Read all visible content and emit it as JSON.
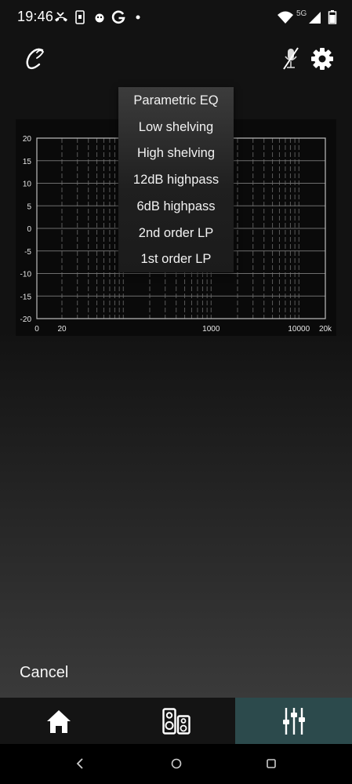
{
  "status_bar": {
    "time": "19:46",
    "network": "5G",
    "icons": [
      "missed-call-icon",
      "phone-debug-icon",
      "alarm-icon",
      "google-icon",
      "dot-icon",
      "wifi-icon",
      "signal-icon",
      "battery-icon"
    ]
  },
  "header": {
    "logo_icon": "app-logo-icon",
    "icons": [
      "mic-muted-icon",
      "gear-icon"
    ]
  },
  "chart_data": {
    "type": "line",
    "title": "",
    "xlabel": "",
    "ylabel": "",
    "x_scale": "log",
    "x_range": [
      0,
      20000
    ],
    "x_tick_labels": [
      "0",
      "20",
      "1000",
      "10000",
      "20k"
    ],
    "ylim": [
      -20,
      20
    ],
    "y_tick_labels": [
      "20",
      "15",
      "10",
      "5",
      "0",
      "-5",
      "-10",
      "-15",
      "-20"
    ],
    "grid": true,
    "series": []
  },
  "dropdown": {
    "items": [
      "Parametric EQ",
      "Low shelving",
      "High shelving",
      "12dB highpass",
      "6dB highpass",
      "2nd order LP",
      "1st order LP"
    ]
  },
  "cancel_label": "Cancel",
  "bottom_nav": {
    "tabs": [
      {
        "icon": "home-icon",
        "active": false
      },
      {
        "icon": "speakers-icon",
        "active": false
      },
      {
        "icon": "sliders-icon",
        "active": true
      }
    ],
    "active_color": "#2c4a4c"
  },
  "system_nav": [
    "back-icon",
    "home-circle-icon",
    "recents-icon"
  ]
}
